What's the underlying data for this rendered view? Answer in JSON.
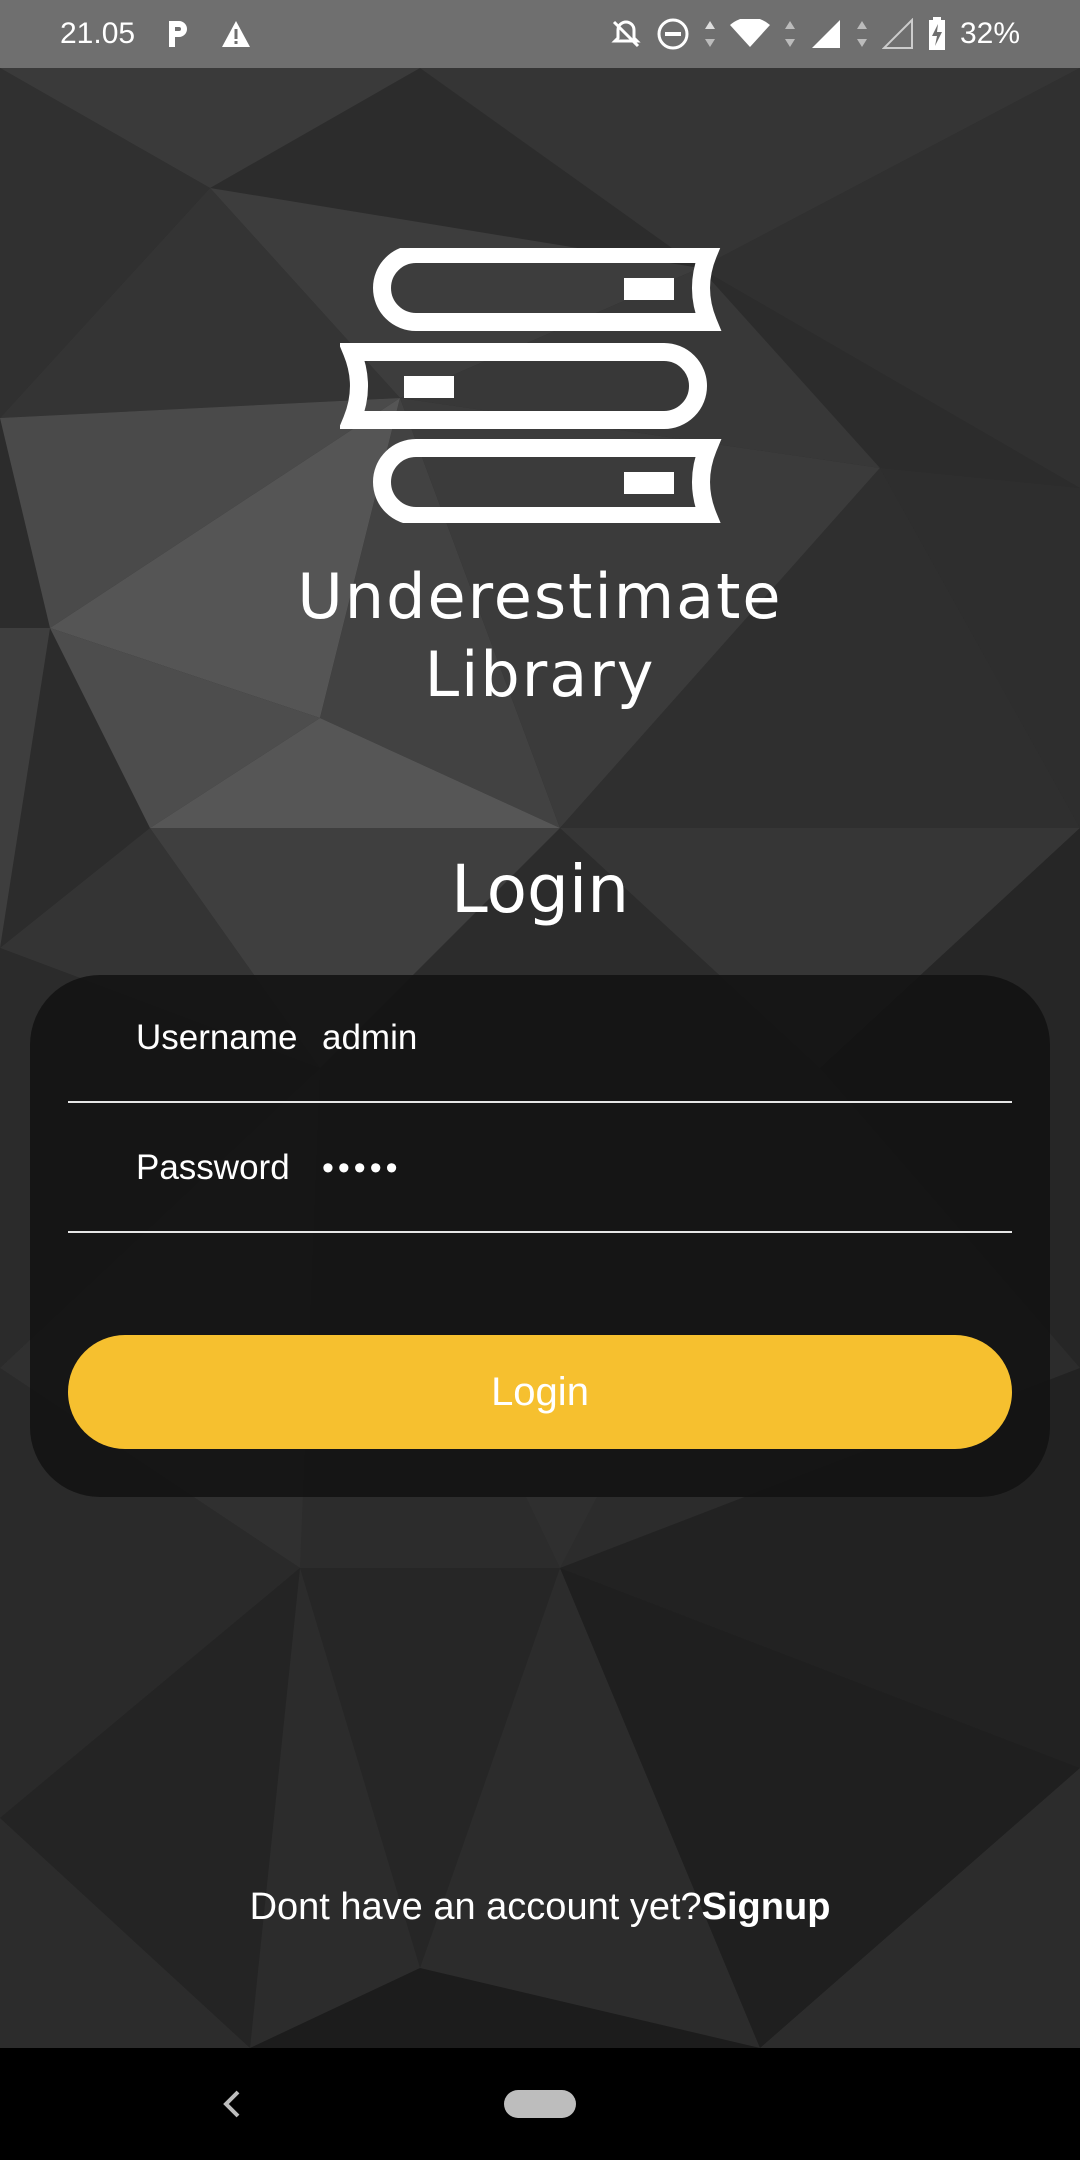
{
  "status_bar": {
    "time": "21.05",
    "battery": "32%",
    "icons": [
      "parking-icon",
      "warning-icon",
      "notifications-off-icon",
      "do-not-disturb-icon",
      "wifi-icon",
      "signal-icon",
      "signal-empty-icon",
      "battery-charging-icon"
    ]
  },
  "app": {
    "title_line1": "Underestimate",
    "title_line2": "Library",
    "logo_icon": "books-stack-icon"
  },
  "login": {
    "heading": "Login",
    "username_label": "Username",
    "username_value": "admin",
    "password_label": "Password",
    "password_value": "•••••",
    "button_label": "Login",
    "button_color": "#f6c02f"
  },
  "signup": {
    "prompt": "Dont have an account yet?",
    "link": "Signup"
  },
  "nav": {
    "icons": [
      "back-icon",
      "home-pill-icon"
    ]
  }
}
